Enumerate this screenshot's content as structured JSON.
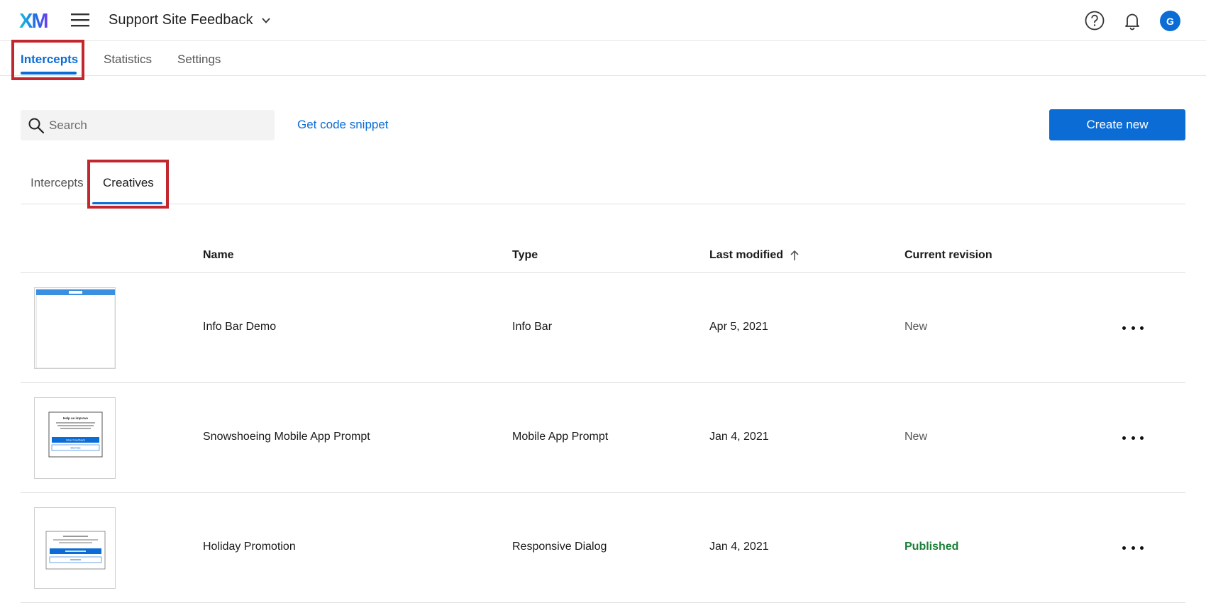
{
  "header": {
    "logo_text": "XM",
    "project_title": "Support Site Feedback",
    "avatar_initial": "G"
  },
  "top_tabs": [
    {
      "label": "Intercepts",
      "active": true
    },
    {
      "label": "Statistics",
      "active": false
    },
    {
      "label": "Settings",
      "active": false
    }
  ],
  "toolbar": {
    "search_placeholder": "Search",
    "code_snippet_link": "Get code snippet",
    "create_button": "Create new"
  },
  "sub_tabs": [
    {
      "label": "Intercepts",
      "active": false
    },
    {
      "label": "Creatives",
      "active": true
    }
  ],
  "table": {
    "columns": [
      "Name",
      "Type",
      "Last modified",
      "Current revision"
    ],
    "sort_column": "Last modified",
    "rows": [
      {
        "name": "Info Bar Demo",
        "type": "Info Bar",
        "last_modified": "Apr 5, 2021",
        "revision": "New"
      },
      {
        "name": "Snowshoeing Mobile App Prompt",
        "type": "Mobile App Prompt",
        "last_modified": "Jan 4, 2021",
        "revision": "New"
      },
      {
        "name": "Holiday Promotion",
        "type": "Responsive Dialog",
        "last_modified": "Jan 4, 2021",
        "revision": "Published"
      }
    ]
  },
  "thumbnails": {
    "mobile_prompt": {
      "title": "Help us improve",
      "button": "Give Feedback",
      "secondary": "Dismiss"
    }
  },
  "colors": {
    "accent": "#0b6cd6",
    "highlight": "#c1272d",
    "published": "#1a7f37"
  }
}
